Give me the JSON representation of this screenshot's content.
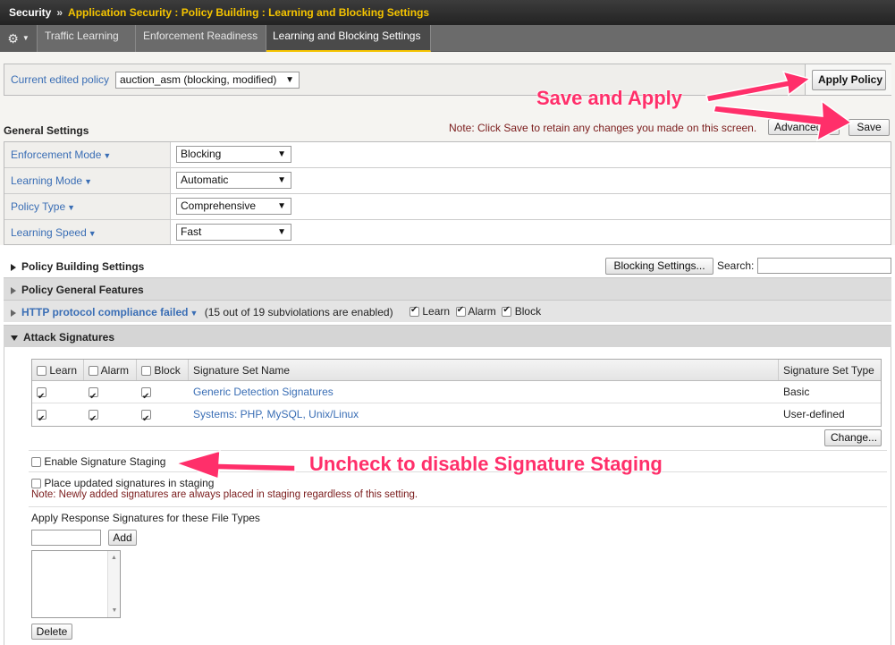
{
  "header": {
    "root": "Security",
    "separator": "»",
    "path": "Application Security : Policy Building : Learning and Blocking Settings"
  },
  "tabs": [
    {
      "label": "Traffic Learning"
    },
    {
      "label": "Enforcement Readiness"
    },
    {
      "label": "Learning and Blocking Settings"
    }
  ],
  "policy_bar": {
    "label": "Current edited policy",
    "selected": "auction_asm (blocking, modified)",
    "apply_button": "Apply Policy"
  },
  "general": {
    "title": "General Settings",
    "note": "Note: Click Save to retain any changes you made on this screen.",
    "advanced_label": "Advanced",
    "save_button": "Save",
    "rows": [
      {
        "label": "Enforcement Mode",
        "value": "Blocking"
      },
      {
        "label": "Learning Mode",
        "value": "Automatic"
      },
      {
        "label": "Policy Type",
        "value": "Comprehensive"
      },
      {
        "label": "Learning Speed",
        "value": "Fast"
      }
    ]
  },
  "policy_building": {
    "title": "Policy Building Settings",
    "blocking_button": "Blocking Settings...",
    "search_label": "Search:"
  },
  "sections": {
    "general_features": "Policy General Features",
    "http_compliance": "HTTP protocol compliance failed",
    "http_count": "(15 out of 19 subviolations are enabled)",
    "learn": "Learn",
    "alarm": "Alarm",
    "block": "Block",
    "attack_signatures": "Attack Signatures"
  },
  "signature_table": {
    "headers": {
      "learn": "Learn",
      "alarm": "Alarm",
      "block": "Block",
      "name": "Signature Set Name",
      "type": "Signature Set Type"
    },
    "rows": [
      {
        "name": "Generic Detection Signatures",
        "type": "Basic"
      },
      {
        "name": "Systems: PHP, MySQL, Unix/Linux",
        "type": "User-defined"
      }
    ],
    "change_button": "Change..."
  },
  "staging": {
    "enable_label": "Enable Signature Staging",
    "place_label": "Place updated signatures in staging",
    "note": "Note: Newly added signatures are always placed in staging regardless of this setting."
  },
  "response": {
    "label": "Apply Response Signatures for these File Types",
    "add_button": "Add",
    "delete_button": "Delete"
  },
  "annotations": {
    "save_apply": "Save and Apply",
    "uncheck": "Uncheck to disable Signature Staging",
    "color": "#ff2f6a"
  }
}
